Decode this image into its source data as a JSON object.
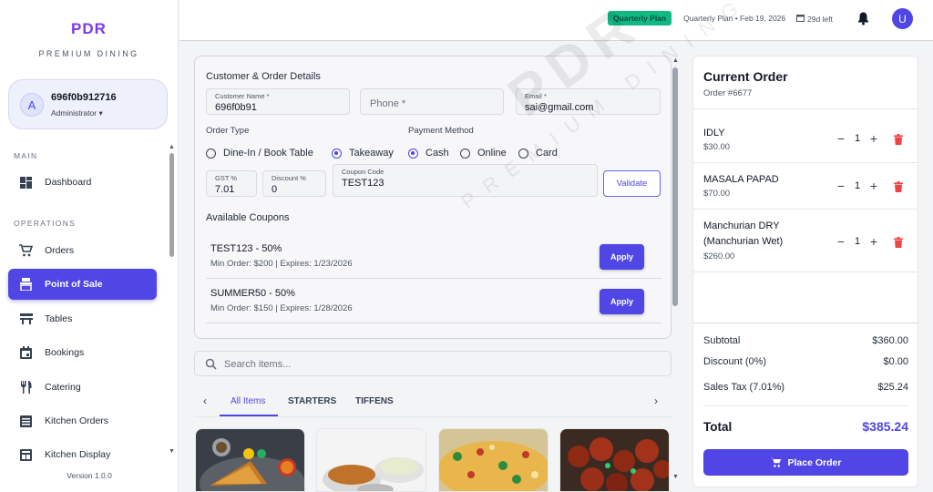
{
  "brand": {
    "title": "PDR",
    "subtitle": "PREMIUM DINING"
  },
  "user": {
    "initial": "A",
    "id": "696f0b912716",
    "role": "Administrator"
  },
  "nav": {
    "main_label": "MAIN",
    "operations_label": "OPERATIONS",
    "items": [
      {
        "label": "Dashboard",
        "icon": "dashboard-icon"
      },
      {
        "label": "Orders",
        "icon": "cart-icon"
      },
      {
        "label": "Point of Sale",
        "icon": "pos-icon",
        "active": true
      },
      {
        "label": "Tables",
        "icon": "table-icon"
      },
      {
        "label": "Bookings",
        "icon": "calendar-icon"
      },
      {
        "label": "Catering",
        "icon": "utensils-icon"
      },
      {
        "label": "Kitchen Orders",
        "icon": "list-icon"
      },
      {
        "label": "Kitchen Display",
        "icon": "monitor-icon"
      }
    ],
    "version": "Version 1.0.0"
  },
  "topbar": {
    "plan_badge": "Quarterly Plan",
    "plan_text": "Quarterly Plan • Feb 19, 2026",
    "days_left": "29d left",
    "avatar_initial": "U"
  },
  "details": {
    "title": "Customer & Order Details",
    "customer_name_label": "Customer Name *",
    "customer_name": "696f0b91",
    "phone_placeholder": "Phone *",
    "email_label": "Email *",
    "email": "sai@gmail.com",
    "order_type_label": "Order Type",
    "order_types": [
      "Dine-In / Book Table",
      "Takeaway"
    ],
    "selected_order_type": "Takeaway",
    "payment_label": "Payment Method",
    "payment_methods": [
      "Cash",
      "Online",
      "Card"
    ],
    "selected_payment": "Cash",
    "gst_label": "GST %",
    "gst": "7.01",
    "discount_label": "Discount %",
    "discount": "0",
    "coupon_label": "Coupon Code",
    "coupon_code": "TEST123",
    "validate_label": "Validate",
    "coupons_title": "Available Coupons",
    "coupons": [
      {
        "name": "TEST123 - 50%",
        "meta": "Min Order: $200 | Expires: 1/23/2026",
        "action": "Apply"
      },
      {
        "name": "SUMMER50 - 50%",
        "meta": "Min Order: $150 | Expires: 1/28/2026",
        "action": "Apply"
      }
    ]
  },
  "search": {
    "placeholder": "Search items..."
  },
  "tabs": [
    "All Items",
    "STARTERS",
    "TIFFENS"
  ],
  "order": {
    "title": "Current Order",
    "number": "Order #6677",
    "items": [
      {
        "name": "IDLY",
        "price": "$30.00",
        "qty": "1"
      },
      {
        "name": "MASALA PAPAD",
        "price": "$70.00",
        "qty": "1"
      },
      {
        "name": "Manchurian DRY (Manchurian Wet)",
        "price": "$260.00",
        "qty": "1"
      }
    ],
    "subtotal_label": "Subtotal",
    "subtotal": "$360.00",
    "discount_label": "Discount (0%)",
    "discount": "$0.00",
    "tax_label": "Sales Tax (7.01%)",
    "tax": "$25.24",
    "total_label": "Total",
    "total": "$385.24",
    "place_label": "Place Order"
  },
  "watermark": {
    "big": "PDR",
    "small": "PREMIUM DINING"
  },
  "colors": {
    "accent": "#4f46e5",
    "brand": "#7c3aed",
    "plan": "#10b981",
    "danger": "#ef4444"
  }
}
